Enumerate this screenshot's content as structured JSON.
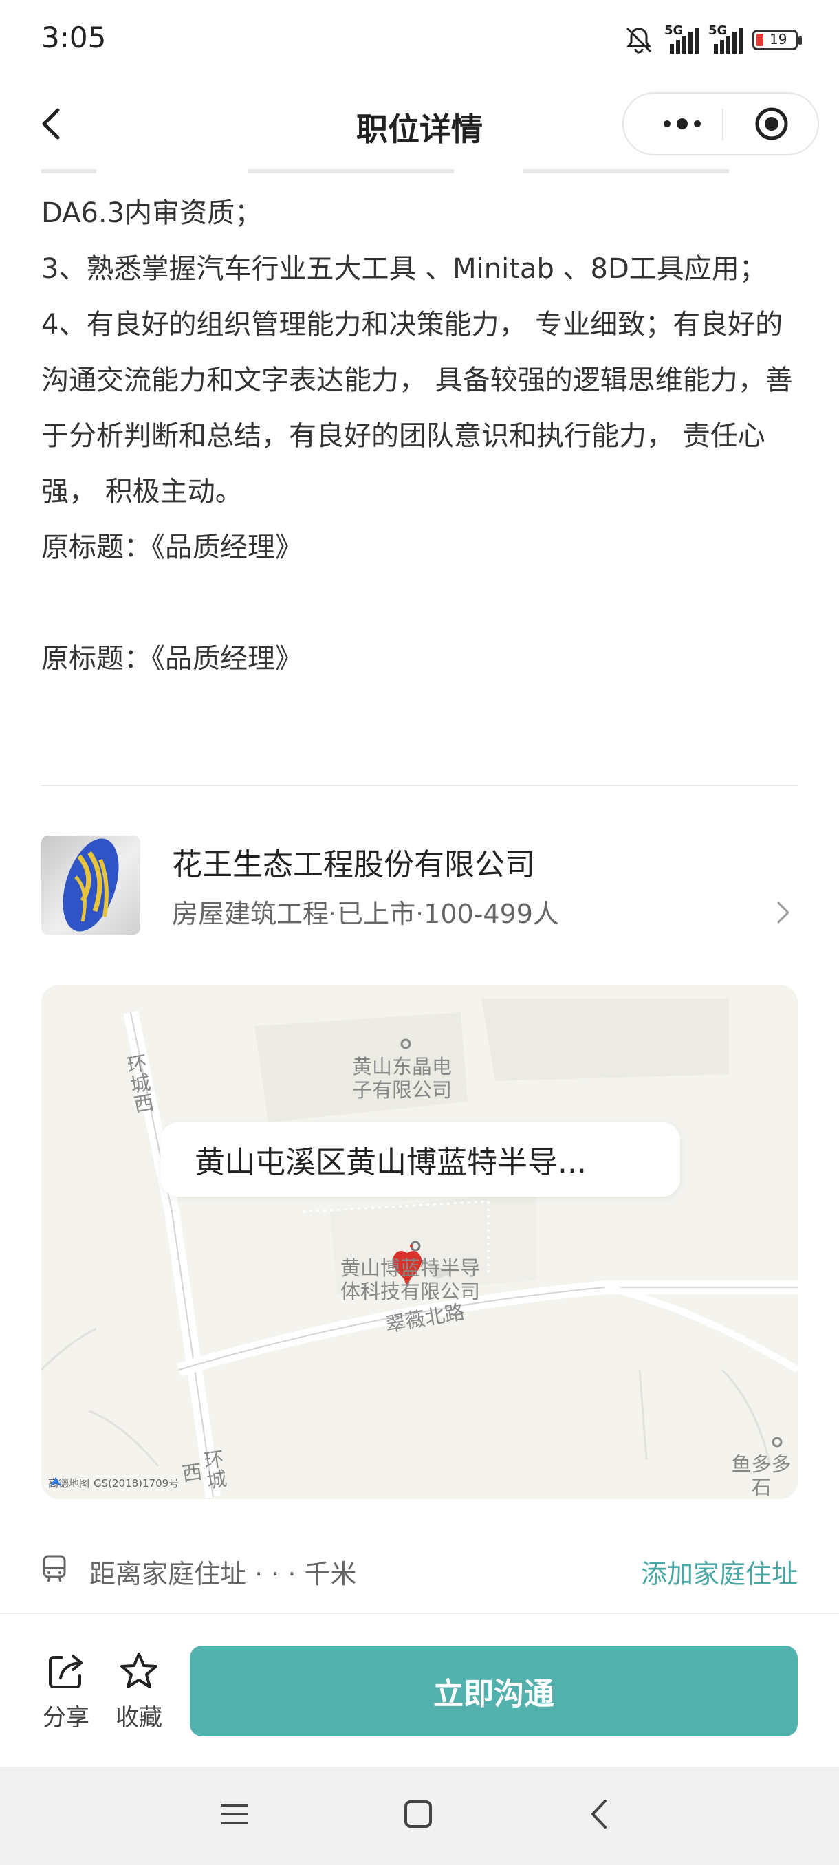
{
  "status_bar": {
    "time": "3:05",
    "network1": "5G",
    "network2": "5G",
    "battery": "19"
  },
  "navbar": {
    "title": "职位详情"
  },
  "description": {
    "lines": [
      "DA6.3内审资质；",
      "3、熟悉掌握汽车行业五大工具 、Minitab 、8D工具应用；",
      "4、有良好的组织管理能力和决策能力， 专业细致；有良好的沟通交流能力和文字表达能力， 具备较强的逻辑思维能力，善于分析判断和总结，有良好的团队意识和执行能力， 责任心强， 积极主动。",
      "原标题：《品质经理》",
      "",
      "原标题：《品质经理》"
    ]
  },
  "company": {
    "name": "花王生态工程股份有限公司",
    "meta": "房屋建筑工程·已上市·100-499人"
  },
  "map": {
    "address": "黄山屯溪区黄山博蓝特半导...",
    "poi_top_line1": "黄山东晶电",
    "poi_top_line2": "子有限公司",
    "poi_main_line1": "黄山博蓝特半导",
    "poi_main_line2": "体科技有限公司",
    "road_cuiwei": "翠薇北路",
    "road_huancheng_top": "环城西",
    "road_huancheng_bottom": "环城西",
    "poi_right": "鱼多多石",
    "credit": "GS(2018)1709号",
    "credit_brand": "高德地图"
  },
  "distance": {
    "label": "距离家庭住址 · · · 千米",
    "add_home": "添加家庭住址"
  },
  "bottom_bar": {
    "share": "分享",
    "favorite": "收藏",
    "chat": "立即沟通"
  },
  "colors": {
    "accent": "#53b1ad",
    "link": "#4aa8a4"
  }
}
